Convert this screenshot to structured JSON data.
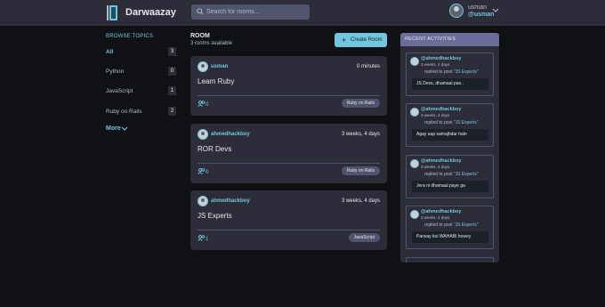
{
  "app": {
    "name": "Darwaazay",
    "search_placeholder": "Search for rooms...",
    "user_name": "usman",
    "user_handle": "@usman"
  },
  "sidebar": {
    "title": "BROWSE TOPICS",
    "topics": [
      {
        "label": "All",
        "count": "3"
      },
      {
        "label": "Python",
        "count": "0"
      },
      {
        "label": "JavaScript",
        "count": "1"
      },
      {
        "label": "Ruby on Rails",
        "count": "2"
      }
    ],
    "more_label": "More"
  },
  "main": {
    "title": "ROOM",
    "count_text": "3 rooms available",
    "create_label": "Create Room",
    "rooms": [
      {
        "author": "usman",
        "time": "0 minutes",
        "name": "Learn Ruby",
        "participants": "0",
        "topic": "Ruby on Rails"
      },
      {
        "author": "ahmedhackboy",
        "time": "3 weeks, 4 days",
        "name": "ROR Devs",
        "participants": "0",
        "topic": "Ruby on Rails"
      },
      {
        "author": "ahmedhackboy",
        "time": "3 weeks, 4 days",
        "name": "JS Experts",
        "participants": "1",
        "topic": "JavaScript"
      }
    ]
  },
  "activities": {
    "title": "RECENT ACTIVITIES",
    "items": [
      {
        "user": "@ahmedhackboy",
        "time": "3 weeks, 4 days",
        "action": "replied to post",
        "post": "\"JS Experts\"",
        "message": "JS Devs, dhamaal pao.."
      },
      {
        "user": "@ahmedhackboy",
        "time": "3 weeks, 4 days",
        "action": "replied to post",
        "post": "\"JS Experts\"",
        "message": "Agay aap samajhdar hain"
      },
      {
        "user": "@ahmedhackboy",
        "time": "3 weeks, 4 days",
        "action": "replied to post",
        "post": "\"JS Experts\"",
        "message": "Jera ni dhamaal paye ga"
      },
      {
        "user": "@ahmedhackboy",
        "time": "3 weeks, 4 days",
        "action": "replied to post",
        "post": "\"JS Experts\"",
        "message": "Parway koi WAHABI howey"
      }
    ]
  },
  "colors": {
    "background": "#0f1115",
    "surface": "#2d2d39",
    "accent": "#71c6dd",
    "header_panel": "#696d97"
  }
}
